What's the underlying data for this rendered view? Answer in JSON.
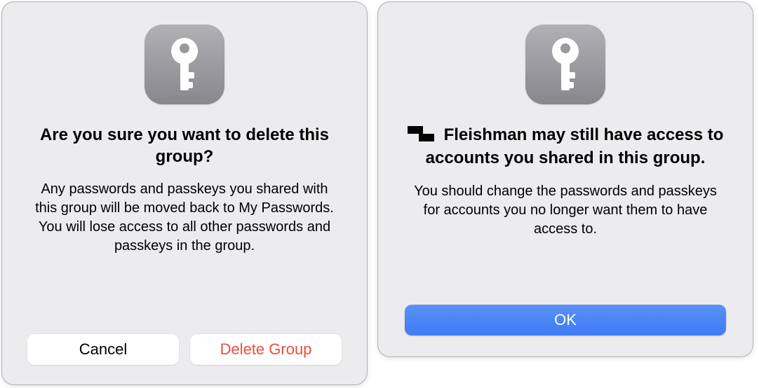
{
  "dialog_left": {
    "heading": "Are you sure you want to delete this group?",
    "body": "Any passwords and passkeys you shared with this group will be moved back to My Passwords. You will lose access to all other passwords and passkeys in the group.",
    "cancel_label": "Cancel",
    "delete_label": "Delete Group"
  },
  "dialog_right": {
    "heading_name": "Fleishman",
    "heading_rest": " may still have access to accounts you shared in this group.",
    "body": "You should change the passwords and passkeys for accounts you no longer want them to have access to.",
    "ok_label": "OK"
  }
}
